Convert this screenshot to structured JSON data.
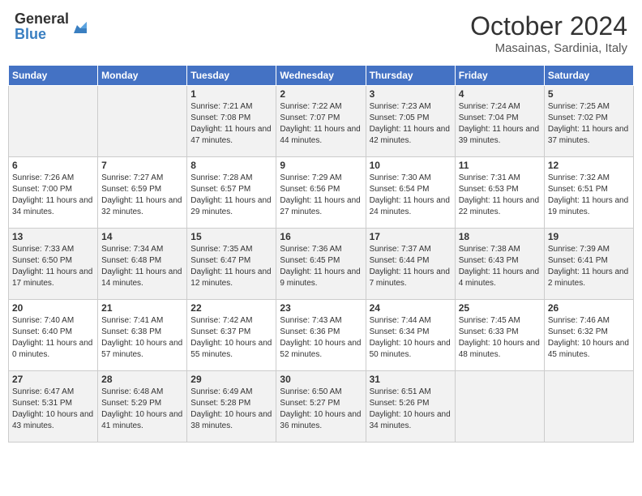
{
  "header": {
    "logo_general": "General",
    "logo_blue": "Blue",
    "month": "October 2024",
    "location": "Masainas, Sardinia, Italy"
  },
  "weekdays": [
    "Sunday",
    "Monday",
    "Tuesday",
    "Wednesday",
    "Thursday",
    "Friday",
    "Saturday"
  ],
  "weeks": [
    [
      {
        "day": "",
        "details": ""
      },
      {
        "day": "",
        "details": ""
      },
      {
        "day": "1",
        "details": "Sunrise: 7:21 AM\nSunset: 7:08 PM\nDaylight: 11 hours and 47 minutes."
      },
      {
        "day": "2",
        "details": "Sunrise: 7:22 AM\nSunset: 7:07 PM\nDaylight: 11 hours and 44 minutes."
      },
      {
        "day": "3",
        "details": "Sunrise: 7:23 AM\nSunset: 7:05 PM\nDaylight: 11 hours and 42 minutes."
      },
      {
        "day": "4",
        "details": "Sunrise: 7:24 AM\nSunset: 7:04 PM\nDaylight: 11 hours and 39 minutes."
      },
      {
        "day": "5",
        "details": "Sunrise: 7:25 AM\nSunset: 7:02 PM\nDaylight: 11 hours and 37 minutes."
      }
    ],
    [
      {
        "day": "6",
        "details": "Sunrise: 7:26 AM\nSunset: 7:00 PM\nDaylight: 11 hours and 34 minutes."
      },
      {
        "day": "7",
        "details": "Sunrise: 7:27 AM\nSunset: 6:59 PM\nDaylight: 11 hours and 32 minutes."
      },
      {
        "day": "8",
        "details": "Sunrise: 7:28 AM\nSunset: 6:57 PM\nDaylight: 11 hours and 29 minutes."
      },
      {
        "day": "9",
        "details": "Sunrise: 7:29 AM\nSunset: 6:56 PM\nDaylight: 11 hours and 27 minutes."
      },
      {
        "day": "10",
        "details": "Sunrise: 7:30 AM\nSunset: 6:54 PM\nDaylight: 11 hours and 24 minutes."
      },
      {
        "day": "11",
        "details": "Sunrise: 7:31 AM\nSunset: 6:53 PM\nDaylight: 11 hours and 22 minutes."
      },
      {
        "day": "12",
        "details": "Sunrise: 7:32 AM\nSunset: 6:51 PM\nDaylight: 11 hours and 19 minutes."
      }
    ],
    [
      {
        "day": "13",
        "details": "Sunrise: 7:33 AM\nSunset: 6:50 PM\nDaylight: 11 hours and 17 minutes."
      },
      {
        "day": "14",
        "details": "Sunrise: 7:34 AM\nSunset: 6:48 PM\nDaylight: 11 hours and 14 minutes."
      },
      {
        "day": "15",
        "details": "Sunrise: 7:35 AM\nSunset: 6:47 PM\nDaylight: 11 hours and 12 minutes."
      },
      {
        "day": "16",
        "details": "Sunrise: 7:36 AM\nSunset: 6:45 PM\nDaylight: 11 hours and 9 minutes."
      },
      {
        "day": "17",
        "details": "Sunrise: 7:37 AM\nSunset: 6:44 PM\nDaylight: 11 hours and 7 minutes."
      },
      {
        "day": "18",
        "details": "Sunrise: 7:38 AM\nSunset: 6:43 PM\nDaylight: 11 hours and 4 minutes."
      },
      {
        "day": "19",
        "details": "Sunrise: 7:39 AM\nSunset: 6:41 PM\nDaylight: 11 hours and 2 minutes."
      }
    ],
    [
      {
        "day": "20",
        "details": "Sunrise: 7:40 AM\nSunset: 6:40 PM\nDaylight: 11 hours and 0 minutes."
      },
      {
        "day": "21",
        "details": "Sunrise: 7:41 AM\nSunset: 6:38 PM\nDaylight: 10 hours and 57 minutes."
      },
      {
        "day": "22",
        "details": "Sunrise: 7:42 AM\nSunset: 6:37 PM\nDaylight: 10 hours and 55 minutes."
      },
      {
        "day": "23",
        "details": "Sunrise: 7:43 AM\nSunset: 6:36 PM\nDaylight: 10 hours and 52 minutes."
      },
      {
        "day": "24",
        "details": "Sunrise: 7:44 AM\nSunset: 6:34 PM\nDaylight: 10 hours and 50 minutes."
      },
      {
        "day": "25",
        "details": "Sunrise: 7:45 AM\nSunset: 6:33 PM\nDaylight: 10 hours and 48 minutes."
      },
      {
        "day": "26",
        "details": "Sunrise: 7:46 AM\nSunset: 6:32 PM\nDaylight: 10 hours and 45 minutes."
      }
    ],
    [
      {
        "day": "27",
        "details": "Sunrise: 6:47 AM\nSunset: 5:31 PM\nDaylight: 10 hours and 43 minutes."
      },
      {
        "day": "28",
        "details": "Sunrise: 6:48 AM\nSunset: 5:29 PM\nDaylight: 10 hours and 41 minutes."
      },
      {
        "day": "29",
        "details": "Sunrise: 6:49 AM\nSunset: 5:28 PM\nDaylight: 10 hours and 38 minutes."
      },
      {
        "day": "30",
        "details": "Sunrise: 6:50 AM\nSunset: 5:27 PM\nDaylight: 10 hours and 36 minutes."
      },
      {
        "day": "31",
        "details": "Sunrise: 6:51 AM\nSunset: 5:26 PM\nDaylight: 10 hours and 34 minutes."
      },
      {
        "day": "",
        "details": ""
      },
      {
        "day": "",
        "details": ""
      }
    ]
  ]
}
